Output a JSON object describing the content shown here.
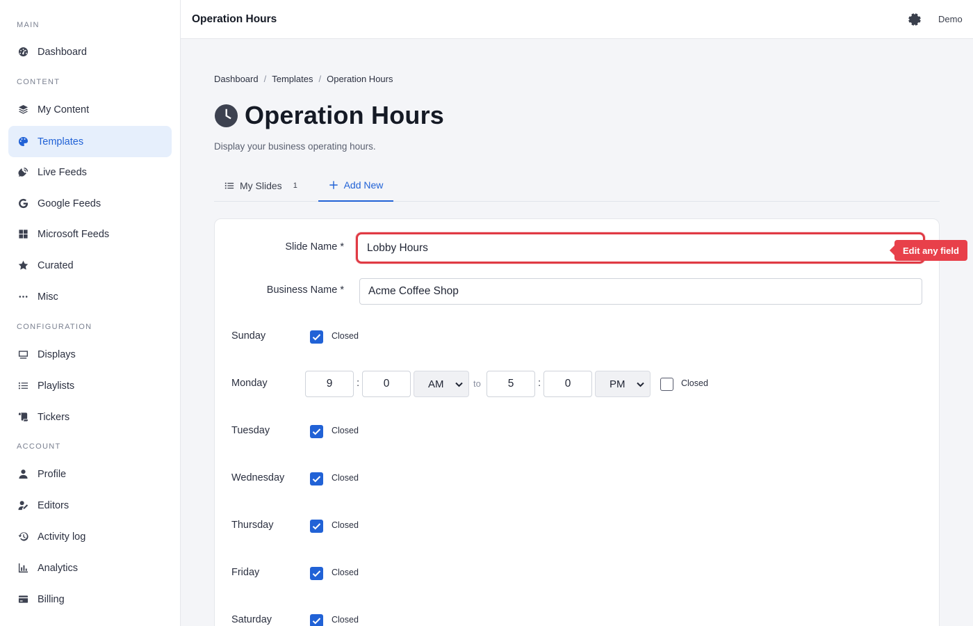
{
  "sidebar": {
    "sections": {
      "main": "MAIN",
      "content": "CONTENT",
      "configuration": "CONFIGURATION",
      "account": "ACCOUNT"
    },
    "items": {
      "dashboard": "Dashboard",
      "my_content": "My Content",
      "templates": "Templates",
      "live_feeds": "Live Feeds",
      "google_feeds": "Google Feeds",
      "microsoft_feeds": "Microsoft Feeds",
      "curated": "Curated",
      "misc": "Misc",
      "displays": "Displays",
      "playlists": "Playlists",
      "tickers": "Tickers",
      "profile": "Profile",
      "editors": "Editors",
      "activity_log": "Activity log",
      "analytics": "Analytics",
      "billing": "Billing"
    },
    "active_item": "Templates",
    "accent_color": "#2162d6"
  },
  "topbar": {
    "title": "Operation Hours",
    "user": "Demo",
    "settings_icon": "gear-icon"
  },
  "breadcrumb": {
    "items": [
      "Dashboard",
      "Templates",
      "Operation Hours"
    ],
    "separator": "/"
  },
  "page": {
    "title": "Operation Hours",
    "icon": "clock-icon",
    "subtitle": "Display your business operating hours."
  },
  "tabs": {
    "my_slides": "My Slides",
    "my_slides_count": "1",
    "add_new": "Add New",
    "active": "Add New"
  },
  "form": {
    "slide_name_label": "Slide Name *",
    "slide_name_value": "Lobby Hours",
    "business_name_label": "Business Name *",
    "business_name_value": "Acme Coffee Shop",
    "tooltip": "Edit any field",
    "closed_label": "Closed",
    "to_label": "to",
    "colon": ":",
    "days": {
      "sunday": {
        "label": "Sunday",
        "closed": true
      },
      "monday": {
        "label": "Monday",
        "closed": false,
        "open_hour": "9",
        "open_minute": "0",
        "open_period": "AM",
        "close_hour": "5",
        "close_minute": "0",
        "close_period": "PM"
      },
      "tuesday": {
        "label": "Tuesday",
        "closed": true
      },
      "wednesday": {
        "label": "Wednesday",
        "closed": true
      },
      "thursday": {
        "label": "Thursday",
        "closed": true
      },
      "friday": {
        "label": "Friday",
        "closed": true
      },
      "saturday": {
        "label": "Saturday",
        "closed": true
      }
    }
  },
  "colors": {
    "highlight_border": "#e03a44",
    "tooltip_bg": "#e8404a",
    "checkbox_checked": "#2162d6"
  }
}
